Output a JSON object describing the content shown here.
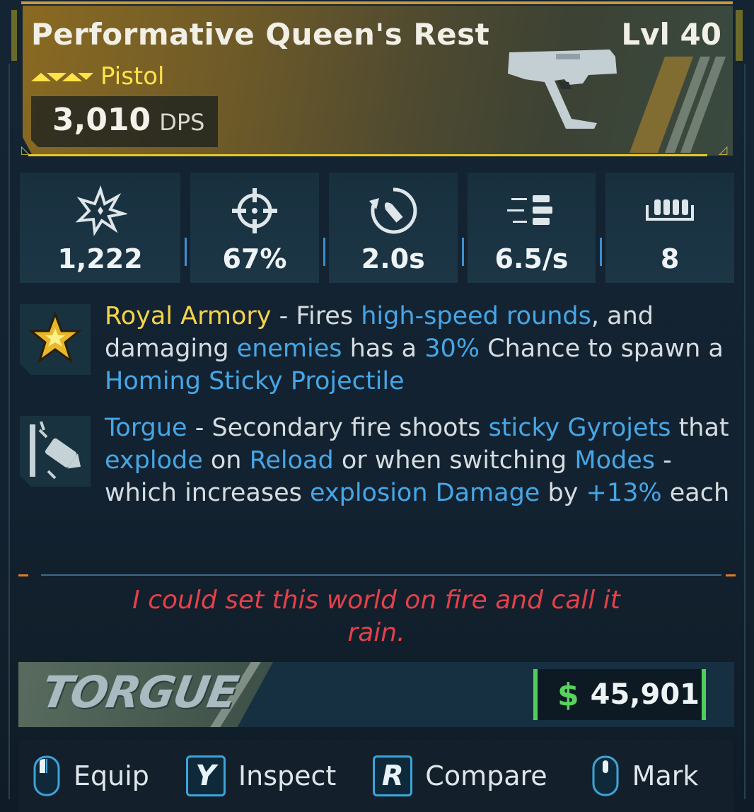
{
  "item": {
    "name": "Performative Queen's Rest",
    "level": "Lvl 40",
    "type": "Pistol",
    "dps_value": "3,010",
    "dps_unit": "DPS",
    "rarity_color": "#ffe24a"
  },
  "stats": [
    {
      "icon": "damage-burst-icon",
      "value": "1,222"
    },
    {
      "icon": "accuracy-crosshair-icon",
      "value": "67%"
    },
    {
      "icon": "reload-icon",
      "value": "2.0s"
    },
    {
      "icon": "fire-rate-icon",
      "value": "6.5/s"
    },
    {
      "icon": "magazine-icon",
      "value": "8"
    }
  ],
  "perks": [
    {
      "icon": "royal-armory-star-icon",
      "segments": [
        {
          "text": "Royal Armory",
          "style": "gold"
        },
        {
          "text": " - Fires ",
          "style": ""
        },
        {
          "text": "high-speed rounds",
          "style": "blue"
        },
        {
          "text": ", and damaging ",
          "style": ""
        },
        {
          "text": "enemies",
          "style": "blue"
        },
        {
          "text": " has a ",
          "style": ""
        },
        {
          "text": "30%",
          "style": "blue"
        },
        {
          "text": " Chance to spawn a ",
          "style": ""
        },
        {
          "text": "Homing Sticky Projectile",
          "style": "blue"
        }
      ]
    },
    {
      "icon": "torgue-gyrojet-icon",
      "segments": [
        {
          "text": "Torgue",
          "style": "blue"
        },
        {
          "text": " - Secondary fire shoots ",
          "style": ""
        },
        {
          "text": "sticky Gyrojets",
          "style": "blue"
        },
        {
          "text": " that ",
          "style": ""
        },
        {
          "text": "explode",
          "style": "blue"
        },
        {
          "text": " on ",
          "style": ""
        },
        {
          "text": "Reload",
          "style": "blue"
        },
        {
          "text": " or when switching ",
          "style": ""
        },
        {
          "text": "Modes",
          "style": "blue"
        },
        {
          "text": " - which increases ",
          "style": ""
        },
        {
          "text": "explosion Damage",
          "style": "blue"
        },
        {
          "text": " by ",
          "style": ""
        },
        {
          "text": "+13%",
          "style": "blue"
        },
        {
          "text": " each",
          "style": ""
        }
      ]
    }
  ],
  "flavor_text": "I could set this world on fire and call it rain.",
  "manufacturer": "TORGUE",
  "price": {
    "symbol": "$",
    "value": "45,901"
  },
  "actions": [
    {
      "key": "mouse",
      "label": "Equip"
    },
    {
      "key": "Y",
      "label": "Inspect"
    },
    {
      "key": "R",
      "label": "Compare"
    },
    {
      "key": "mouse",
      "label": "Mark"
    }
  ],
  "colors": {
    "accent_gold": "#f5d34a",
    "accent_blue": "#46a6e6",
    "flavor_red": "#e5404a",
    "price_green": "#58d35e"
  }
}
